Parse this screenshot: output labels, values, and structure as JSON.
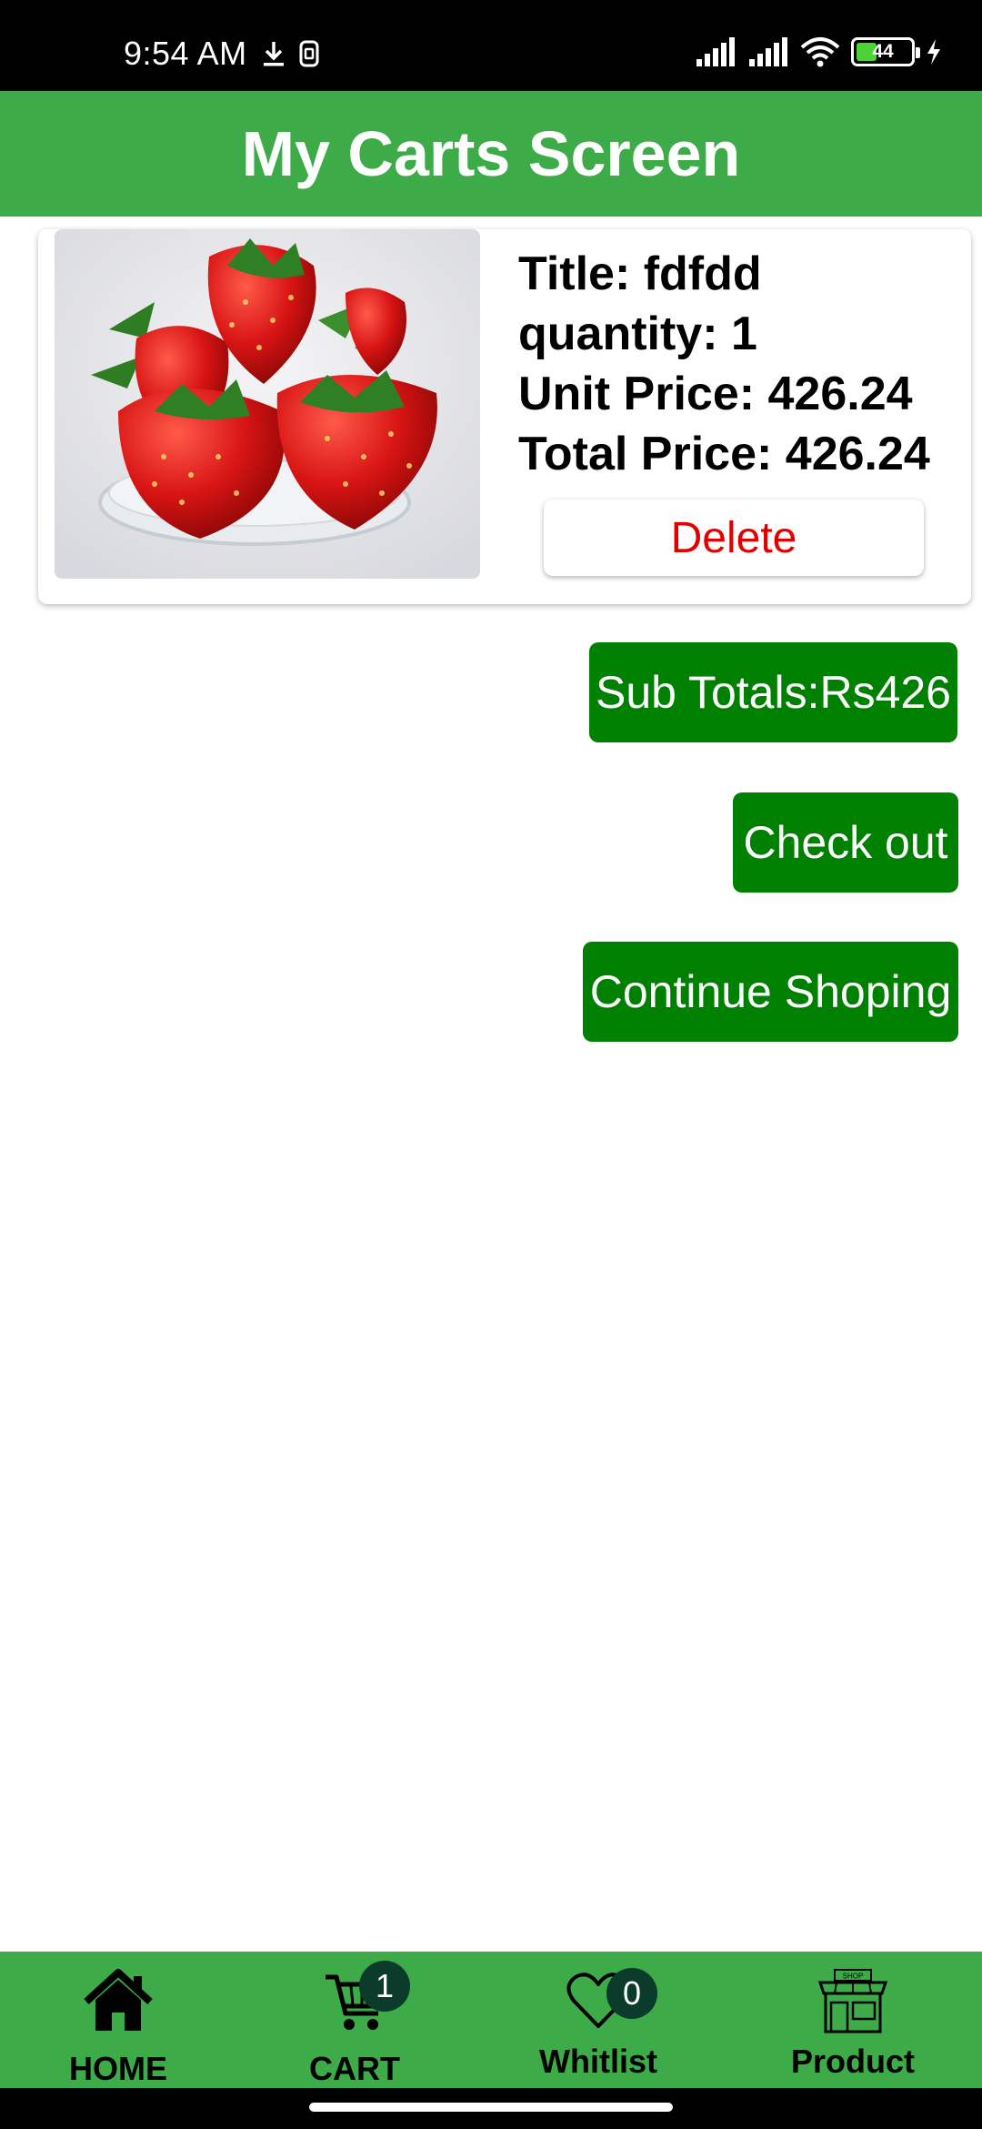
{
  "status_bar": {
    "time": "9:54 AM",
    "battery_level": "44",
    "battery_fraction": 0.44,
    "icons": [
      "download-icon",
      "sim-icon",
      "signal-icon",
      "wifi-icon",
      "battery-icon",
      "charging-icon"
    ]
  },
  "header": {
    "title": "My Carts Screen"
  },
  "cart": {
    "items": [
      {
        "image": "strawberries",
        "title": "Title: fdfdd",
        "quantity": "quantity: 1",
        "unit_price": "Unit Price: 426.24",
        "total_price": "Total Price: 426.24",
        "delete_label": "Delete"
      }
    ]
  },
  "actions": {
    "subtotal": "Sub Totals:Rs426",
    "checkout": "Check out",
    "continue": "Continue Shoping"
  },
  "bottom_nav": {
    "items": [
      {
        "label": "HOME",
        "icon": "home-icon"
      },
      {
        "label": "CART",
        "icon": "cart-icon",
        "badge": "1"
      },
      {
        "label": "Whitlist",
        "icon": "heart-icon",
        "badge": "0"
      },
      {
        "label": "Product",
        "icon": "shop-icon",
        "icon_text": "SHOP"
      }
    ]
  },
  "colors": {
    "app_bar": "#3dab48",
    "action_button": "#008000",
    "delete_text": "#e00000",
    "badge": "#0b3b2a"
  }
}
